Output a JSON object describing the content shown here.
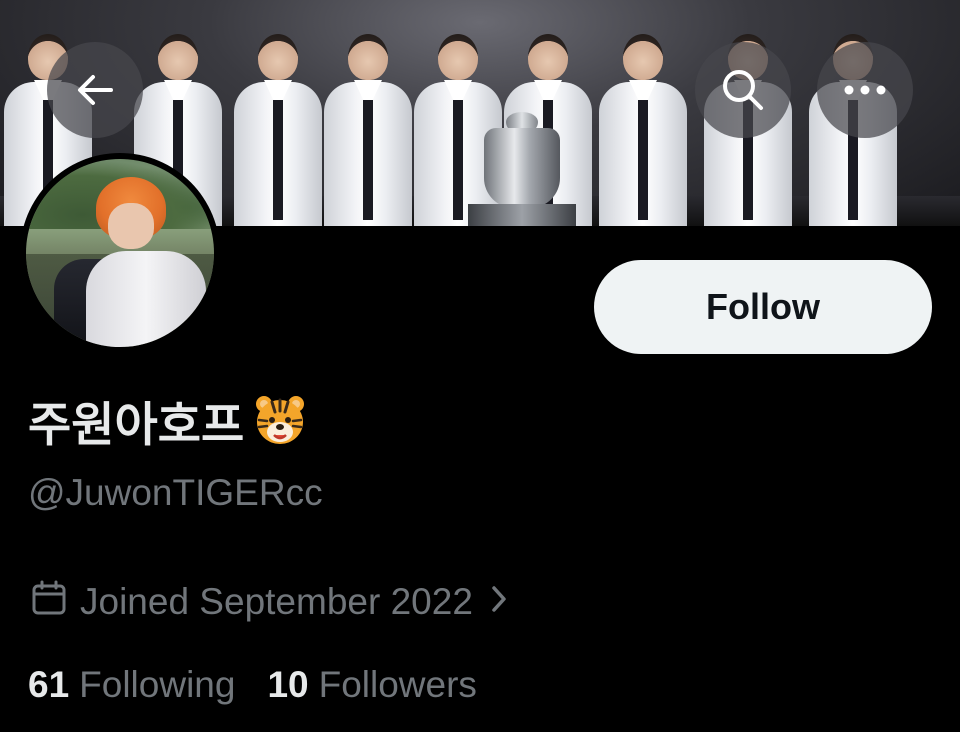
{
  "header": {
    "back_icon": "arrow-left-icon",
    "search_icon": "search-icon",
    "more_icon": "more-horizontal-icon"
  },
  "profile": {
    "display_name": "주원아호프",
    "display_name_emoji": "tiger-face-emoji",
    "handle": "@JuwonTIGERcc",
    "joined": "Joined September 2022",
    "follow_label": "Follow"
  },
  "stats": {
    "following_count": "61",
    "following_label": "Following",
    "followers_count": "10",
    "followers_label": "Followers"
  },
  "colors": {
    "background": "#000000",
    "primary_text": "#e7e9ea",
    "secondary_text": "#71767b",
    "follow_button_bg": "#eff3f4",
    "follow_button_text": "#0f1419"
  }
}
